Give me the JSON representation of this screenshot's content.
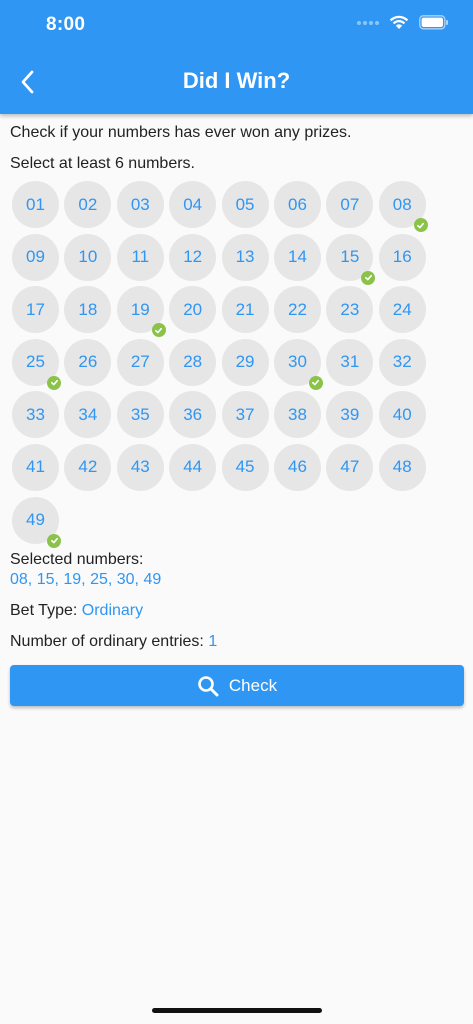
{
  "status_bar": {
    "time": "8:00"
  },
  "header": {
    "title": "Did I Win?"
  },
  "intro_text": "Check if your numbers has ever won any prizes.",
  "instruction_text": "Select at least 6 numbers.",
  "numbers": [
    "01",
    "02",
    "03",
    "04",
    "05",
    "06",
    "07",
    "08",
    "09",
    "10",
    "11",
    "12",
    "13",
    "14",
    "15",
    "16",
    "17",
    "18",
    "19",
    "20",
    "21",
    "22",
    "23",
    "24",
    "25",
    "26",
    "27",
    "28",
    "29",
    "30",
    "31",
    "32",
    "33",
    "34",
    "35",
    "36",
    "37",
    "38",
    "39",
    "40",
    "41",
    "42",
    "43",
    "44",
    "45",
    "46",
    "47",
    "48",
    "49"
  ],
  "selected": [
    "08",
    "15",
    "19",
    "25",
    "30",
    "49"
  ],
  "selected_label": "Selected numbers:",
  "selected_value": "08, 15, 19, 25, 30, 49",
  "bet_type_label": "Bet Type:",
  "bet_type_value": "Ordinary",
  "entries_label": "Number of ordinary entries:",
  "entries_value": "1",
  "check_button_label": "Check",
  "colors": {
    "primary": "#2f96f3",
    "check_badge": "#8bc34a",
    "ball_bg": "#e6e6e6"
  }
}
